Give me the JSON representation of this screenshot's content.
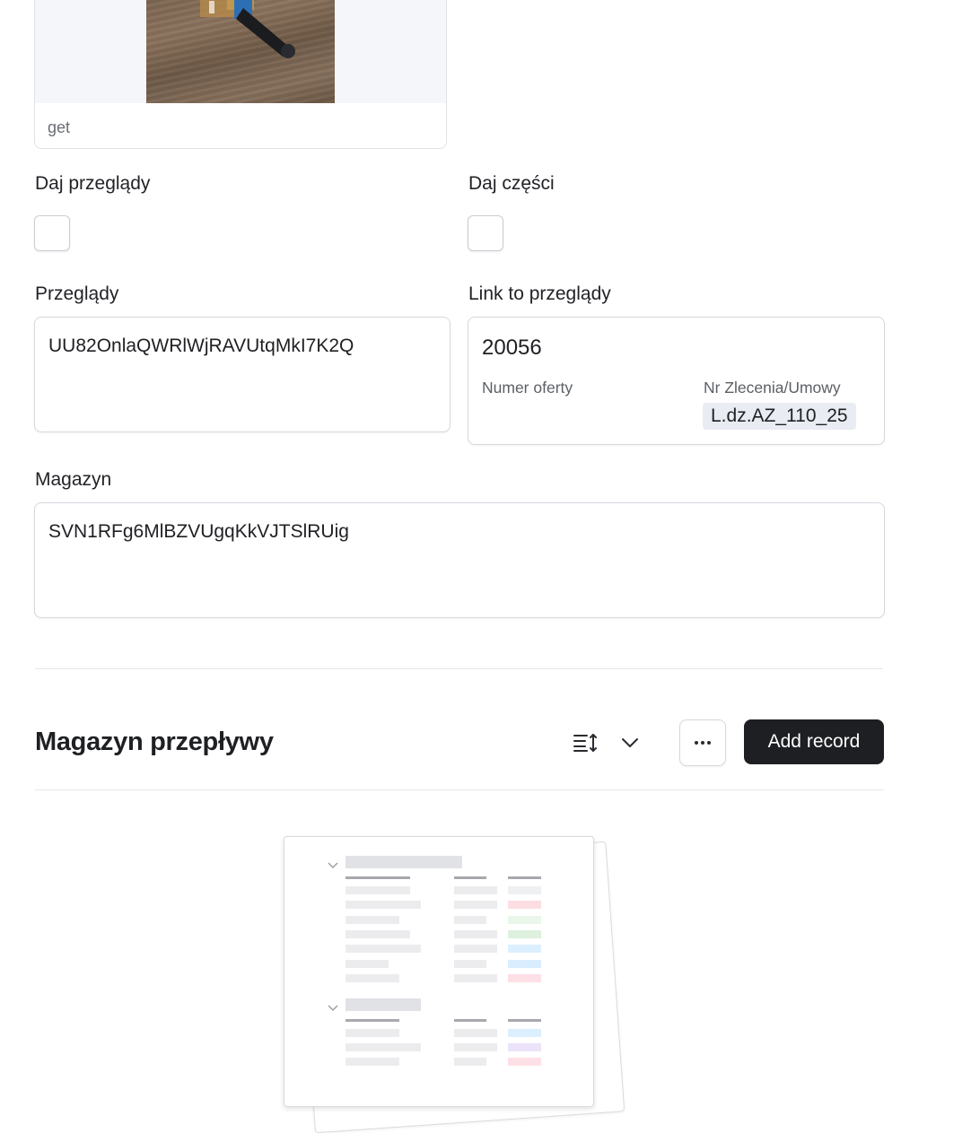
{
  "image_field": {
    "caption": "get"
  },
  "checkboxes": [
    {
      "label": "Daj przeglądy"
    },
    {
      "label": "Daj części"
    }
  ],
  "fields": {
    "przeglady": {
      "label": "Przeglądy",
      "value": "UU82OnlaQWRlWjRAVUtqMkI7K2Q"
    },
    "link": {
      "label": "Link to przeglądy",
      "value": "20056",
      "numer_oferty_label": "Numer oferty",
      "nr_zlecenia_label": "Nr Zlecenia/Umowy",
      "nr_zlecenia_value": "L.dz.AZ_110_25"
    },
    "magazyn": {
      "label": "Magazyn",
      "value": "SVN1RFg6MlBZVUgqKkVJTSlRUig"
    }
  },
  "section": {
    "title": "Magazyn przepływy",
    "sort_icon": "sort-icon",
    "chevron_icon": "chevron-down-icon",
    "more_icon": "more-horizontal-icon",
    "add_label": "Add record"
  },
  "empty_state": {
    "illustration": "empty-table-illustration"
  },
  "colors": {
    "primary_button": "#1e1f23",
    "tag_background": "#e9ecf3",
    "border": "#d5d8de"
  }
}
